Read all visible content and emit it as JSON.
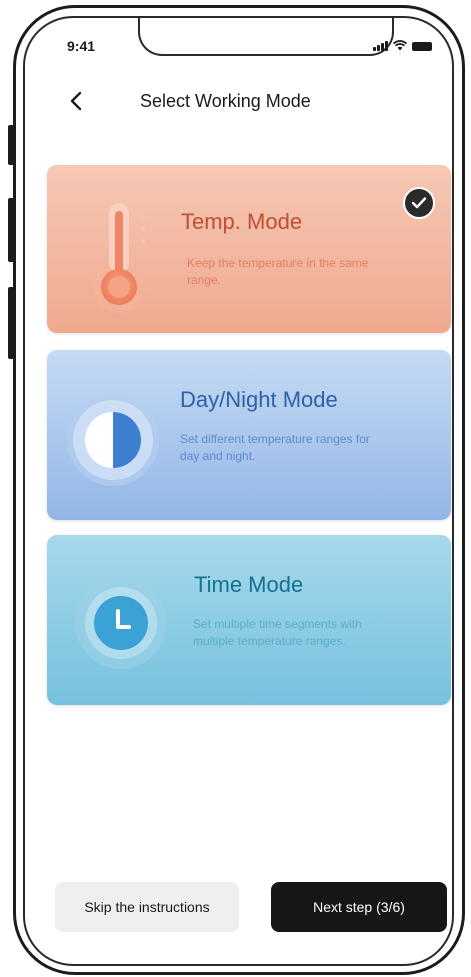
{
  "status_bar": {
    "time": "9:41"
  },
  "header": {
    "title": "Select Working Mode"
  },
  "modes": [
    {
      "title": "Temp. Mode",
      "description": "Keep the temperature in the same range.",
      "selected": true,
      "icon": "thermometer-icon",
      "accent": "#c04f34"
    },
    {
      "title": "Day/Night Mode",
      "description": "Set different temperature ranges for day and night.",
      "selected": false,
      "icon": "day-night-icon",
      "accent": "#2e62a6"
    },
    {
      "title": "Time Mode",
      "description": "Set multiple time segments with multiple temperature ranges.",
      "selected": false,
      "icon": "clock-icon",
      "accent": "#16708f"
    }
  ],
  "footer": {
    "skip_label": "Skip the instructions",
    "next_label": "Next step (3/6)"
  }
}
